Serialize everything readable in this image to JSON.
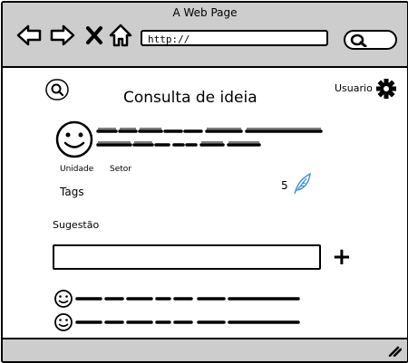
{
  "window": {
    "title": "A Web Page"
  },
  "browser": {
    "url": "http://",
    "back_icon": "arrow-left",
    "forward_icon": "arrow-right",
    "stop_icon": "x",
    "home_icon": "house",
    "search_icon": "magnifier"
  },
  "header": {
    "page_title": "Consulta de ideia",
    "user_label": "Usuario"
  },
  "idea": {
    "unit_label": "Unidade",
    "sector_label": "Setor",
    "tags_label": "Tags",
    "like_count": "5"
  },
  "suggestion": {
    "label": "Sugestão",
    "input_value": "",
    "add_symbol": "+"
  },
  "colors": {
    "chrome": "#cdcdcd",
    "accent_feather": "#3b8fd0"
  }
}
